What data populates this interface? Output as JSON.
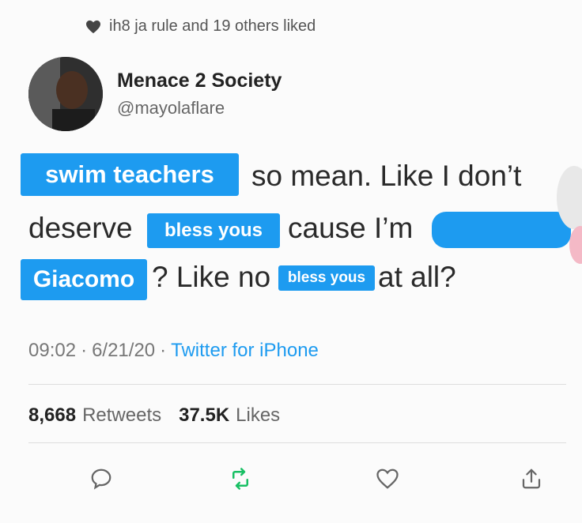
{
  "liked": {
    "icon": "heart-icon",
    "text": "ih8 ja rule and 19 others liked"
  },
  "user": {
    "name": "Menace 2 Society",
    "handle": "@mayolaflare",
    "avatar": "avatar"
  },
  "tweet": {
    "highlight_1": "swim teachers",
    "text_1": "so mean. Like I don’t",
    "text_2": "deserve",
    "highlight_2": "bless yous",
    "text_3": "cause I’m",
    "highlight_3": "Giacomo",
    "text_4": "? Like no",
    "highlight_4": "bless yous",
    "text_5": "at all?"
  },
  "meta": {
    "time": "09:02",
    "sep1": "·",
    "date": "6/21/20",
    "sep2": "·",
    "source": "Twitter for iPhone"
  },
  "stats": {
    "retweets_count": "8,668",
    "retweets_label": "Retweets",
    "likes_count": "37.5K",
    "likes_label": "Likes"
  },
  "actions": [
    "reply-icon",
    "retweet-icon",
    "like-icon",
    "share-icon"
  ],
  "colors": {
    "highlight": "#1d9bf0",
    "retweet": "#17bf63"
  }
}
